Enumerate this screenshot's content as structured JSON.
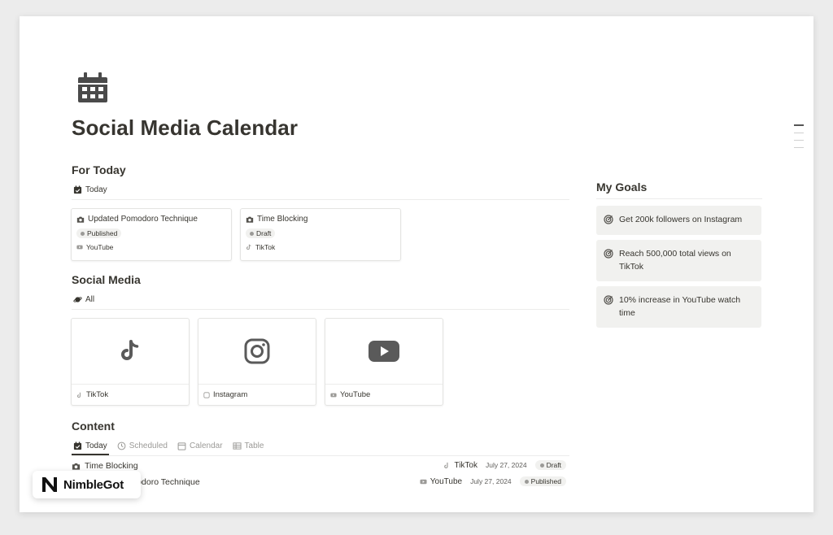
{
  "page": {
    "title": "Social Media Calendar",
    "icon": "calendar-icon"
  },
  "for_today": {
    "title": "For Today",
    "view_tab": "Today",
    "cards": [
      {
        "title": "Updated Pomodoro Technique",
        "status": "Published",
        "platform": "YouTube"
      },
      {
        "title": "Time Blocking",
        "status": "Draft",
        "platform": "TikTok"
      }
    ]
  },
  "social_media": {
    "title": "Social Media",
    "view_tab": "All",
    "cards": [
      {
        "label": "TikTok",
        "icon": "tiktok-icon"
      },
      {
        "label": "Instagram",
        "icon": "instagram-icon"
      },
      {
        "label": "YouTube",
        "icon": "youtube-icon"
      }
    ]
  },
  "goals": {
    "title": "My Goals",
    "items": [
      {
        "text": "Get 200k followers on Instagram"
      },
      {
        "text": "Reach 500,000 total views on TikTok"
      },
      {
        "text": "10% increase in YouTube watch time"
      }
    ]
  },
  "content": {
    "title": "Content",
    "tabs": [
      {
        "label": "Today",
        "active": true
      },
      {
        "label": "Scheduled",
        "active": false
      },
      {
        "label": "Calendar",
        "active": false
      },
      {
        "label": "Table",
        "active": false
      }
    ],
    "rows": [
      {
        "name": "Time Blocking",
        "platform": "TikTok",
        "date": "July 27, 2024",
        "status": "Draft"
      },
      {
        "name": "Updated Pomodoro Technique",
        "platform": "YouTube",
        "date": "July 27, 2024",
        "status": "Published"
      }
    ]
  },
  "brand": {
    "name": "NimbleGot"
  },
  "colors": {
    "accent": "#37352f",
    "muted": "#9b9a97",
    "pill_bg": "#f1f1ef",
    "goal_bg": "#f1f1ef"
  }
}
